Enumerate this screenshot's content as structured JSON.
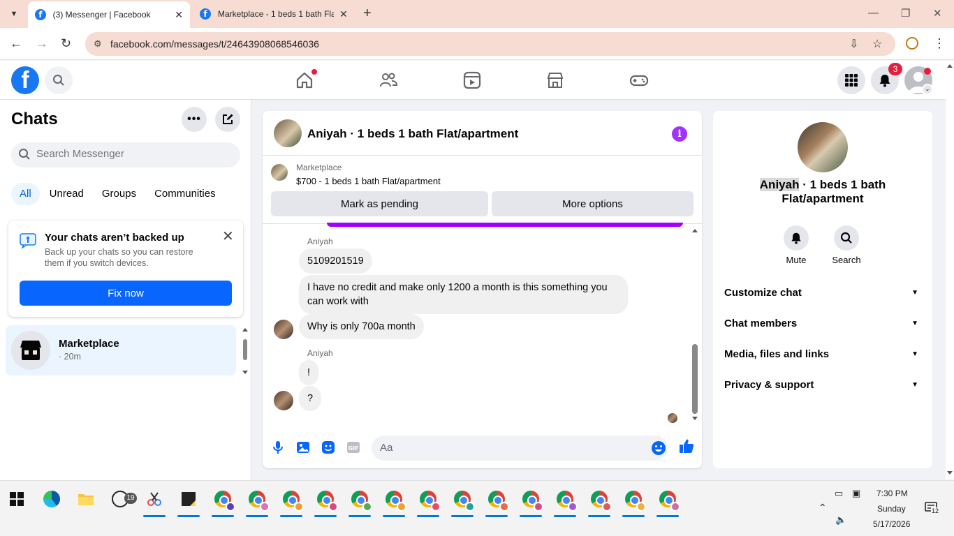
{
  "browser": {
    "tabs": [
      {
        "title": "(3) Messenger | Facebook",
        "active": true
      },
      {
        "title": "Marketplace - 1 beds 1 bath Flat/apartment",
        "active": false
      }
    ],
    "url": "facebook.com/messages/t/24643908068546036"
  },
  "fb_nav": {
    "notifications_badge": "3"
  },
  "chats_panel": {
    "title": "Chats",
    "search_placeholder": "Search Messenger",
    "filters": [
      "All",
      "Unread",
      "Groups",
      "Communities"
    ],
    "backup_card": {
      "title": "Your chats aren’t backed up",
      "description": "Back up your chats so you can restore them if you switch devices.",
      "button": "Fix now"
    },
    "chat_list": [
      {
        "name": "Marketplace",
        "time": "· 20m"
      }
    ]
  },
  "conversation": {
    "header_title": "Aniyah · 1 beds 1 bath Flat/apartment",
    "marketplace_label": "Marketplace",
    "listing_title": "$700 - 1 beds 1 bath Flat/apartment",
    "mark_pending_button": "Mark as pending",
    "more_options_button": "More options",
    "messages": {
      "sender1": "Aniyah",
      "msg1": "5109201519",
      "msg2": "I have no credit and make only 1200 a month is this something you can work with",
      "msg3": "Why is only 700a month",
      "sender2": "Aniyah",
      "msg4": "!",
      "msg5": "?"
    },
    "composer_placeholder": "Aa"
  },
  "info_panel": {
    "name_highlight": "Aniyah",
    "name_rest": " · 1 beds 1 bath Flat/apartment",
    "actions": [
      {
        "label": "Mute",
        "icon": "bell-icon"
      },
      {
        "label": "Search",
        "icon": "search-icon"
      }
    ],
    "sections": [
      "Customize chat",
      "Chat members",
      "Media, files and links",
      "Privacy & support"
    ]
  },
  "taskbar": {
    "whatsapp_badge": "19",
    "time": "7:30 PM",
    "day": "Sunday",
    "date": "5/17/2026",
    "notification_count": "12"
  },
  "colors": {
    "facebook_blue": "#1877f2",
    "messenger_purple": "#a033ff",
    "notification_red": "#e41e3f"
  }
}
